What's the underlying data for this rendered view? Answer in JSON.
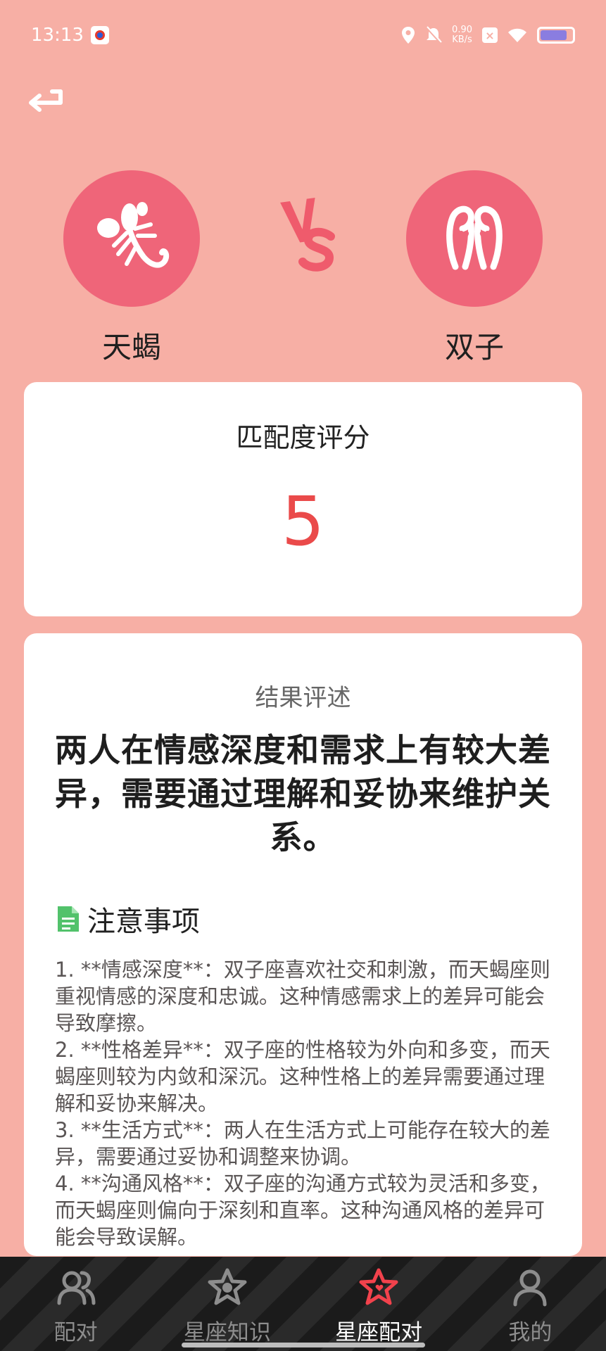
{
  "status_bar": {
    "time": "13:13",
    "net_speed_value": "0.90",
    "net_speed_unit": "KB/s",
    "battery_level": 0.85
  },
  "pair": {
    "left": {
      "name": "天蝎",
      "icon": "scorpio-icon"
    },
    "right": {
      "name": "双子",
      "icon": "gemini-icon"
    },
    "vs_icon": "vs-icon"
  },
  "score": {
    "title": "匹配度评分",
    "value": "5"
  },
  "result": {
    "label": "结果评述",
    "summary": "两人在情感深度和需求上有较大差异，需要通过理解和妥协来维护关系。",
    "notes_title": "注意事项",
    "notes": [
      "1. **情感深度**：双子座喜欢社交和刺激，而天蝎座则重视情感的深度和忠诚。这种情感需求上的差异可能会导致摩擦。",
      "2. **性格差异**：双子座的性格较为外向和多变，而天蝎座则较为内敛和深沉。这种性格上的差异需要通过理解和妥协来解决。",
      "3. **生活方式**：两人在生活方式上可能存在较大的差异，需要通过妥协和调整来协调。",
      "4. **沟通风格**：双子座的沟通方式较为灵活和多变，而天蝎座则偏向于深刻和直率。这种沟通风格的差异可能会导致误解。"
    ]
  },
  "nav": {
    "items": [
      {
        "label": "配对",
        "icon": "people-icon",
        "active": false
      },
      {
        "label": "星座知识",
        "icon": "star-badge-icon",
        "active": false
      },
      {
        "label": "星座配对",
        "icon": "star-heart-icon",
        "active": true
      },
      {
        "label": "我的",
        "icon": "person-icon",
        "active": false
      }
    ]
  },
  "colors": {
    "background": "#f7afa5",
    "accent": "#ea4a4a",
    "avatar": "#ef6579",
    "nav_bg": "#1b1b1b"
  }
}
